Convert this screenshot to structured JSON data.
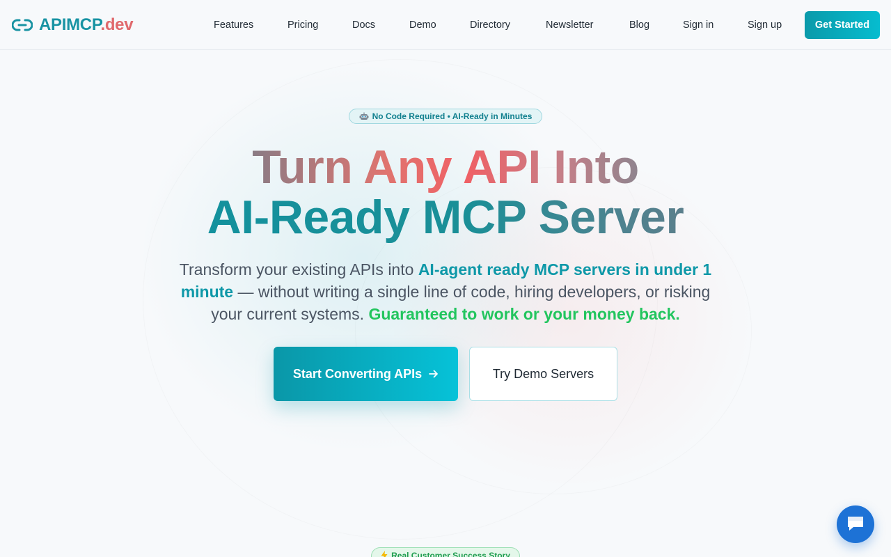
{
  "brand": {
    "name_main": "APIMCP",
    "name_suffix": ".dev",
    "icon": "link-icon",
    "colors": {
      "primary": "#1893a3",
      "accent": "#e0696c"
    }
  },
  "nav": {
    "items": [
      {
        "label": "Features"
      },
      {
        "label": "Pricing"
      },
      {
        "label": "Docs"
      },
      {
        "label": "Demo"
      },
      {
        "label": "Directory"
      },
      {
        "label": "Newsletter"
      },
      {
        "label": "Blog"
      },
      {
        "label": "Sign in"
      },
      {
        "label": "Sign up"
      }
    ],
    "cta_label": "Get Started"
  },
  "hero": {
    "badge": {
      "icon": "robot-icon",
      "text": "No Code Required • AI-Ready in Minutes"
    },
    "title_line1": "Turn Any API Into",
    "title_line2": "AI-Ready MCP Server",
    "subtitle": {
      "part1": "Transform your existing APIs into ",
      "highlight1": "AI-agent ready MCP servers in under 1 minute",
      "part2": " — without writing a single line of code, hiring developers, or risking your current systems. ",
      "highlight2": "Guaranteed to work or your money back."
    },
    "primary_button": {
      "label": "Start Converting APIs",
      "icon": "arrow-right-icon"
    },
    "secondary_button": {
      "label": "Try Demo Servers"
    }
  },
  "next_section": {
    "badge": {
      "icon": "lightning-icon",
      "text": "Real Customer Success Story"
    }
  },
  "chat_widget": {
    "icon": "chat-icon",
    "color": "#1d72d6"
  }
}
